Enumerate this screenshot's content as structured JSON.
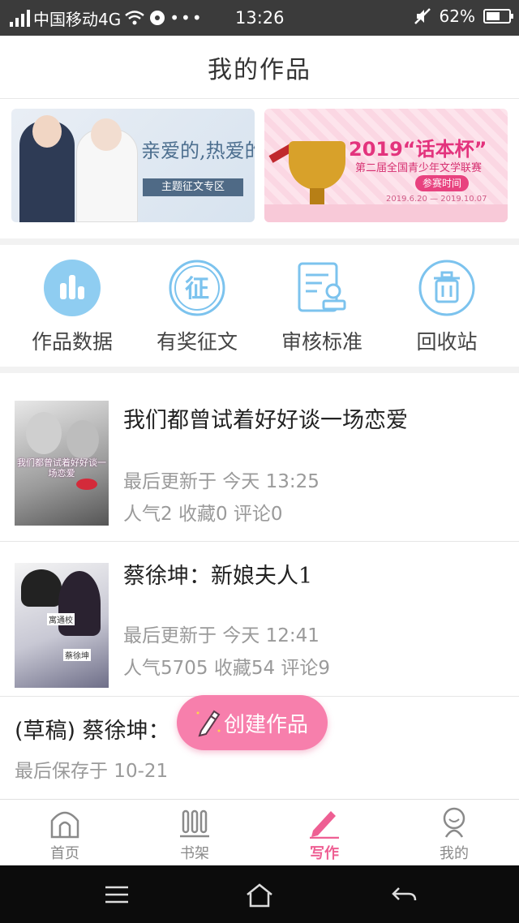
{
  "status_bar": {
    "carrier": "中国移动4G",
    "time": "13:26",
    "battery": "62%",
    "battery_level": 0.62
  },
  "header": {
    "title": "我的作品"
  },
  "banners": [
    {
      "title": "亲爱的,热爱的",
      "tag": "主题征文专区"
    },
    {
      "title": "2019“话本杯”",
      "subtitle": "第二届全国青少年文学联赛",
      "pill": "参赛时间",
      "dates": "2019.6.20 — 2019.10.07"
    }
  ],
  "actions": [
    {
      "label": "作品数据",
      "icon": "chart-icon"
    },
    {
      "label": "有奖征文",
      "icon": "contest-icon"
    },
    {
      "label": "审核标准",
      "icon": "review-icon"
    },
    {
      "label": "回收站",
      "icon": "trash-icon"
    }
  ],
  "works": [
    {
      "title": "我们都曾试着好好谈一场恋爱",
      "cover_text": "我们都曾试着好好谈一场恋爱",
      "updated": "最后更新于 今天 13:25",
      "stats": "人气2 收藏0 评论0"
    },
    {
      "title": "蔡徐坤：新娘夫人1",
      "cover_tag1": "寓通校",
      "cover_tag2": "蔡徐坤",
      "updated": "最后更新于 今天 12:41",
      "stats": "人气5705 收藏54 评论9"
    },
    {
      "title": "(草稿) 蔡徐坤：",
      "saved": "最后保存于 10-21"
    }
  ],
  "fab": {
    "label": "创建作品"
  },
  "tabs": [
    {
      "label": "首页",
      "icon": "home-icon"
    },
    {
      "label": "书架",
      "icon": "bookshelf-icon"
    },
    {
      "label": "写作",
      "icon": "pen-icon",
      "active": true
    },
    {
      "label": "我的",
      "icon": "profile-icon"
    }
  ],
  "colors": {
    "accent": "#ee5f93",
    "fab": "#f77fac",
    "icon_blue": "#7cc3ee"
  }
}
